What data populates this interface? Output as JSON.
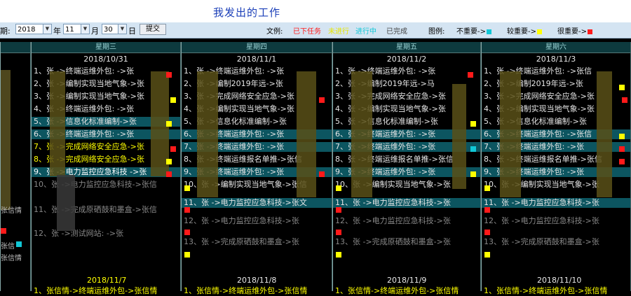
{
  "title": "我发出的工作",
  "toolbar": {
    "date_label_tail": "期:",
    "year_value": "2018",
    "year_suffix": "年",
    "month_value": "11",
    "month_suffix": "月",
    "day_value": "30",
    "day_suffix": "日",
    "submit_label": "提交",
    "legend_text_label": "文例:",
    "status_overdue": "已下任务",
    "status_notstarted": "未进行",
    "status_inprogress": "进行中",
    "status_done": "已完成",
    "legend_label": "图例:",
    "legend_low": "不重要->",
    "legend_mid": "较重要->",
    "legend_high": "很重要->",
    "colors": {
      "low": "#11c7d6",
      "mid": "#ffff00",
      "high": "#ff1a1a"
    }
  },
  "columns": [
    {
      "weekday": "星期三",
      "date": "2018/10/31",
      "items": [
        "1、张 ->终端运维外包: ->张",
        "2、张 ->编制实现当地气象->张",
        "3、张 ->编制实现当地气象->张",
        "4、张 ->终端运维外包: ->张",
        "5、张 ->信息化标准编制->张",
        "6、张 ->终端运维外包: ->张",
        "7、张 ->完成网络安全应急->张",
        "8、张 ->完成网络安全应急->张",
        "9、张 ->电力监控应急科技 ->张",
        "10、张 ->电力监控应急科技->张信",
        "11、张 ->完成原硒鼓和墨盒->张信",
        "12、张 ->测试网站: ->张"
      ]
    },
    {
      "weekday": "星期四",
      "date": "2018/11/1",
      "items": [
        "1、张 ->终端运维外包: ->张",
        "2、张 ->编制2019年远->张",
        "3、张 ->完成网络安全应急->张",
        "4、张 ->编制实现当地气象->张",
        "5、张 ->信息化标准编制->张",
        "6、张 ->终端运维外包: ->张",
        "7、张 ->终端运维外包: ->张",
        "8、张 ->终端运维报名单推->张信",
        "9、张 ->终端运维外包: ->张",
        "10、张 ->编制实现当地气象->张信",
        "11、张 ->电力监控应急科技->张文",
        "12、张 ->电力监控应急科技->张",
        "13、张 ->完成原硒鼓和墨盒->张",
        "14、张 ->测试网站: ->张"
      ]
    },
    {
      "weekday": "星期五",
      "date": "2018/11/2",
      "items": [
        "1、张 ->终端运维外包: ->张",
        "2、张 ->编制2019年远->马",
        "3、张 ->完成网络安全应急->张",
        "4、张 ->编制实现当地气象->张",
        "5、张 ->信息化标准编制->张",
        "6、张 ->终端运维外包: ->张",
        "7、张 ->终端运维外包: ->张",
        "8、张 ->终端运维报名单推->张信",
        "9、张 ->终端运维外包: ->张",
        "10、张 ->编制实现当地气象->张",
        "11、张 ->电力监控应急科技->张",
        "12、张 ->电力监控应急科技->张",
        "13、张 ->完成原硒鼓和墨盒->张",
        "14、张 ->测试网站: ->张"
      ]
    },
    {
      "weekday": "星期六",
      "date": "2018/11/3",
      "items": [
        "1、张 ->终端运维外包: ->张信",
        "2、张 ->编制2019年远->张",
        "3、张 ->完成网络安全应急->张",
        "4、张 ->编制实现当地气象->张",
        "5、张 ->信息化标准编制->张",
        "6、张 ->终端运维外包: ->张信",
        "7、张 ->终端运维外包: ->张",
        "8、张 ->终端运维报名单推->张信",
        "9、张 ->终端运维外包: ->张",
        "10、张 ->编制实现当地气象->张",
        "11、张 ->电力监控应急科技->张",
        "12、张 ->电力监控应急科技->张",
        "13、张 ->完成原硒鼓和墨盒->张",
        "14、张 ->测试网站: ->张"
      ]
    }
  ],
  "left_partial": {
    "items": [
      "张信情",
      "张信",
      "张信情"
    ]
  },
  "next_week": {
    "dates": [
      "2018/11/7",
      "2018/11/8",
      "2018/11/9",
      "2018/11/10"
    ],
    "first_item": "1、张信情->终端运维外包->张信情"
  }
}
